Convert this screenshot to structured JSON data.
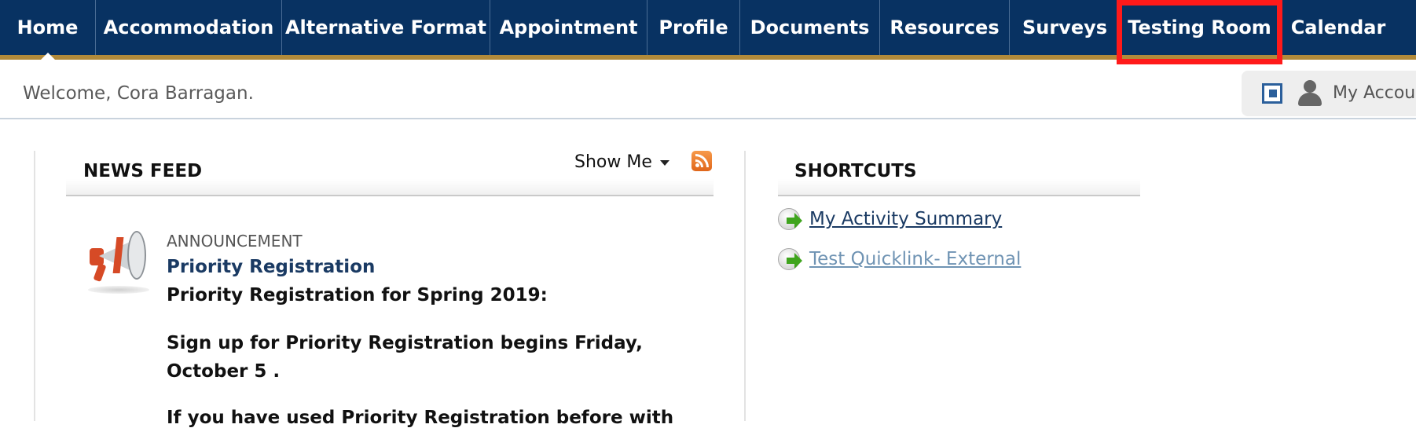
{
  "nav": {
    "items": [
      {
        "label": "Home"
      },
      {
        "label": "Accommodation"
      },
      {
        "label": "Alternative Format"
      },
      {
        "label": "Appointment"
      },
      {
        "label": "Profile"
      },
      {
        "label": "Documents"
      },
      {
        "label": "Resources"
      },
      {
        "label": "Surveys"
      },
      {
        "label": "Testing Room"
      },
      {
        "label": "Calendar"
      }
    ],
    "active": "Home",
    "highlighted": "Testing Room"
  },
  "welcome": {
    "text": "Welcome, Cora Barragan.",
    "account_label": "My Accou"
  },
  "news_feed": {
    "title": "NEWS FEED",
    "show_me_label": "Show Me",
    "item": {
      "kind": "ANNOUNCEMENT",
      "title": "Priority Registration",
      "line1": "Priority Registration for Spring 2019:",
      "line2": "Sign up for Priority Registration begins Friday,",
      "line3": "October 5 .",
      "line4": "If you have used Priority Registration before with"
    }
  },
  "shortcuts": {
    "title": "SHORTCUTS",
    "items": [
      {
        "label": "My Activity Summary"
      },
      {
        "label": "Test Quicklink- External"
      }
    ]
  },
  "colors": {
    "nav_bg": "#083262",
    "nav_underline": "#b18a3a",
    "highlight": "#ff1a1a",
    "link_visited": "#1a3a63",
    "link_external": "#6f93b3"
  }
}
